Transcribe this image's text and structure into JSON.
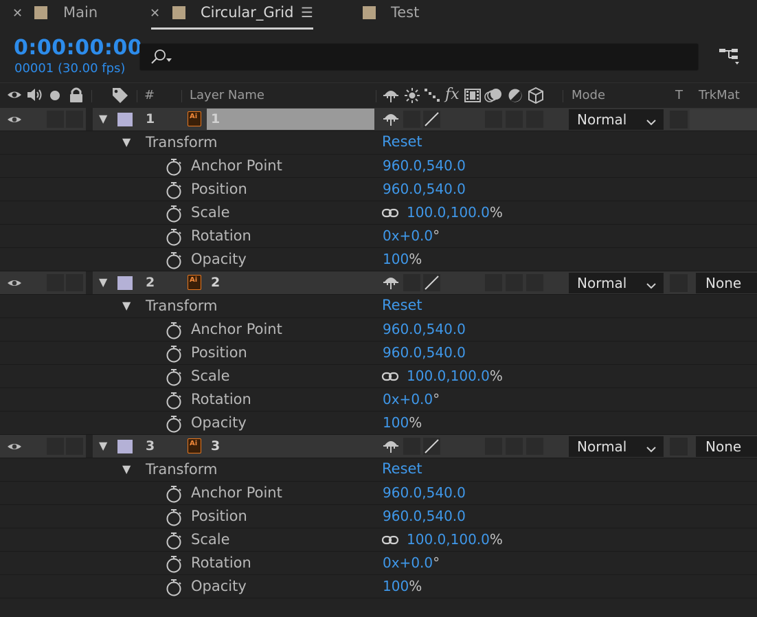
{
  "tabs": [
    {
      "label": "Main",
      "closable": true,
      "active": false
    },
    {
      "label": "Circular_Grid",
      "closable": true,
      "active": true
    },
    {
      "label": "Test",
      "closable": false,
      "active": false
    }
  ],
  "timecode": "0:00:00:00",
  "frame_info": "00001 (30.00 fps)",
  "search": {
    "placeholder": ""
  },
  "header": {
    "num": "#",
    "layer_name": "Layer Name",
    "fx": "fx",
    "mode": "Mode",
    "t": "T",
    "trkmat": "TrkMat"
  },
  "layers": [
    {
      "num": "1",
      "name": "1",
      "ai_icon": "Ai",
      "mode": "Normal",
      "trkmat": "",
      "transform": "Transform",
      "reset": "Reset",
      "props": [
        {
          "label": "Anchor Point",
          "value": "960.0,540.0",
          "unit": ""
        },
        {
          "label": "Position",
          "value": "960.0,540.0",
          "unit": ""
        },
        {
          "label": "Scale",
          "value": "100.0,100.0",
          "unit": "%"
        },
        {
          "label": "Rotation",
          "value": "0x+0.0",
          "unit": "°"
        },
        {
          "label": "Opacity",
          "value": "100",
          "unit": "%"
        }
      ]
    },
    {
      "num": "2",
      "name": "2",
      "ai_icon": "Ai",
      "mode": "Normal",
      "trkmat": "None",
      "transform": "Transform",
      "reset": "Reset",
      "props": [
        {
          "label": "Anchor Point",
          "value": "960.0,540.0",
          "unit": ""
        },
        {
          "label": "Position",
          "value": "960.0,540.0",
          "unit": ""
        },
        {
          "label": "Scale",
          "value": "100.0,100.0",
          "unit": "%"
        },
        {
          "label": "Rotation",
          "value": "0x+0.0",
          "unit": "°"
        },
        {
          "label": "Opacity",
          "value": "100",
          "unit": "%"
        }
      ]
    },
    {
      "num": "3",
      "name": "3",
      "ai_icon": "Ai",
      "mode": "Normal",
      "trkmat": "None",
      "transform": "Transform",
      "reset": "Reset",
      "props": [
        {
          "label": "Anchor Point",
          "value": "960.0,540.0",
          "unit": ""
        },
        {
          "label": "Position",
          "value": "960.0,540.0",
          "unit": ""
        },
        {
          "label": "Scale",
          "value": "100.0,100.0",
          "unit": "%"
        },
        {
          "label": "Rotation",
          "value": "0x+0.0",
          "unit": "°"
        },
        {
          "label": "Opacity",
          "value": "100",
          "unit": "%"
        }
      ]
    }
  ],
  "colors": {
    "accent": "#2d8ceb",
    "value_blue": "#3f98ea",
    "tab_swatch": "#b4a182",
    "label_lavender": "#b4b1d6",
    "ai_orange": "#e8771e"
  }
}
